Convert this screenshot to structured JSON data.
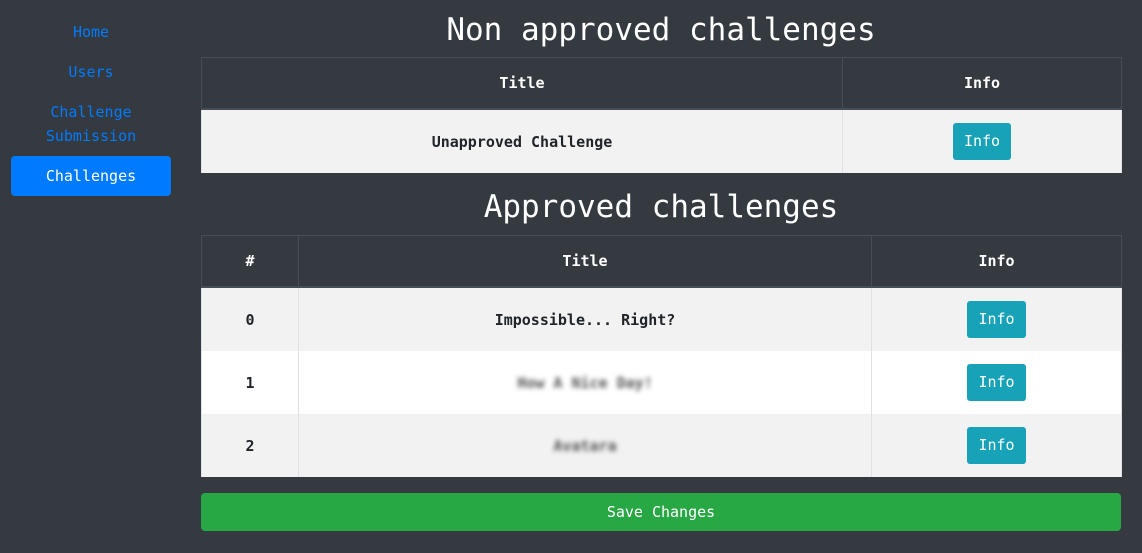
{
  "sidebar": {
    "items": [
      {
        "label": "Home"
      },
      {
        "label": "Users"
      },
      {
        "label": "Challenge Submission"
      },
      {
        "label": "Challenges",
        "active": true
      }
    ]
  },
  "non_approved": {
    "heading": "Non approved challenges",
    "columns": [
      "Title",
      "Info"
    ],
    "rows": [
      {
        "title": "Unapproved Challenge",
        "button": "Info"
      }
    ]
  },
  "approved": {
    "heading": "Approved challenges",
    "columns": [
      "#",
      "Title",
      "Info"
    ],
    "rows": [
      {
        "index": "0",
        "title": "Impossible... Right?",
        "button": "Info"
      },
      {
        "index": "1",
        "title": "How A Nice Day!",
        "button": "Info",
        "obscured": true
      },
      {
        "index": "2",
        "title": "Avatara",
        "button": "Info",
        "obscured": true
      }
    ]
  },
  "save_label": "Save Changes",
  "colors": {
    "background": "#343a40",
    "primary": "#007bff",
    "info": "#17a2b8",
    "success": "#28a745"
  }
}
